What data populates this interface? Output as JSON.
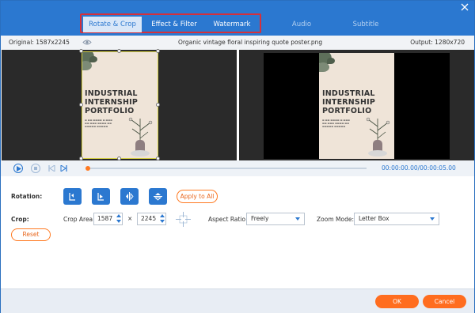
{
  "tabs": [
    {
      "label": "Rotate & Crop",
      "active": true
    },
    {
      "label": "Effect & Filter",
      "active": false
    },
    {
      "label": "Watermark",
      "active": false
    },
    {
      "label": "Audio",
      "active": false
    },
    {
      "label": "Subtitle",
      "active": false
    }
  ],
  "window": {
    "close_icon": "close-icon"
  },
  "info": {
    "original": "Original: 1587x2245",
    "filename": "Organic vintage floral inspiring quote  poster.png",
    "output": "Output: 1280x720"
  },
  "poster": {
    "title": "INDUSTRIAL INTERNSHIP PORTFOLIO",
    "line1": "INDUSTRIAL",
    "line2": "INTERNSHIP",
    "line3": "PORTFOLIO"
  },
  "transport": {
    "current_time": "00:00:00.00",
    "total_time": "/00:00:05.00",
    "progress": 0
  },
  "rotation": {
    "label": "Rotation:",
    "apply_all": "Apply to All"
  },
  "crop": {
    "label": "Crop:",
    "area_label": "Crop Area:",
    "width": "1587",
    "height": "2245",
    "times": "×",
    "aspect_label": "Aspect Ratio:",
    "aspect_value": "Freely",
    "zoom_label": "Zoom Mode:",
    "zoom_value": "Letter Box",
    "reset": "Reset"
  },
  "footer": {
    "ok": "OK",
    "cancel": "Cancel"
  },
  "colors": {
    "title_bar": "#2b78d0",
    "accent_orange": "#ff6d1f",
    "highlight_red": "#d6303a"
  }
}
